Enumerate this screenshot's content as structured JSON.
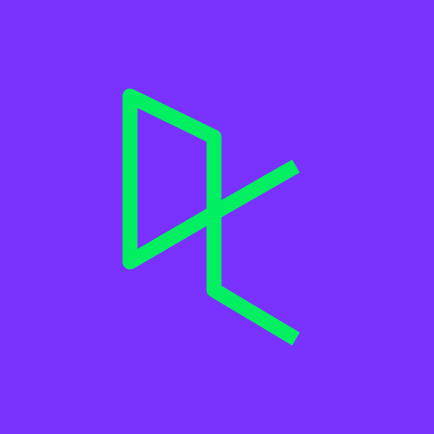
{
  "app_icon": {
    "icon_name": "datacamp-logo-icon",
    "colors": {
      "background": "#7932FF",
      "mark": "#03EF62"
    }
  }
}
